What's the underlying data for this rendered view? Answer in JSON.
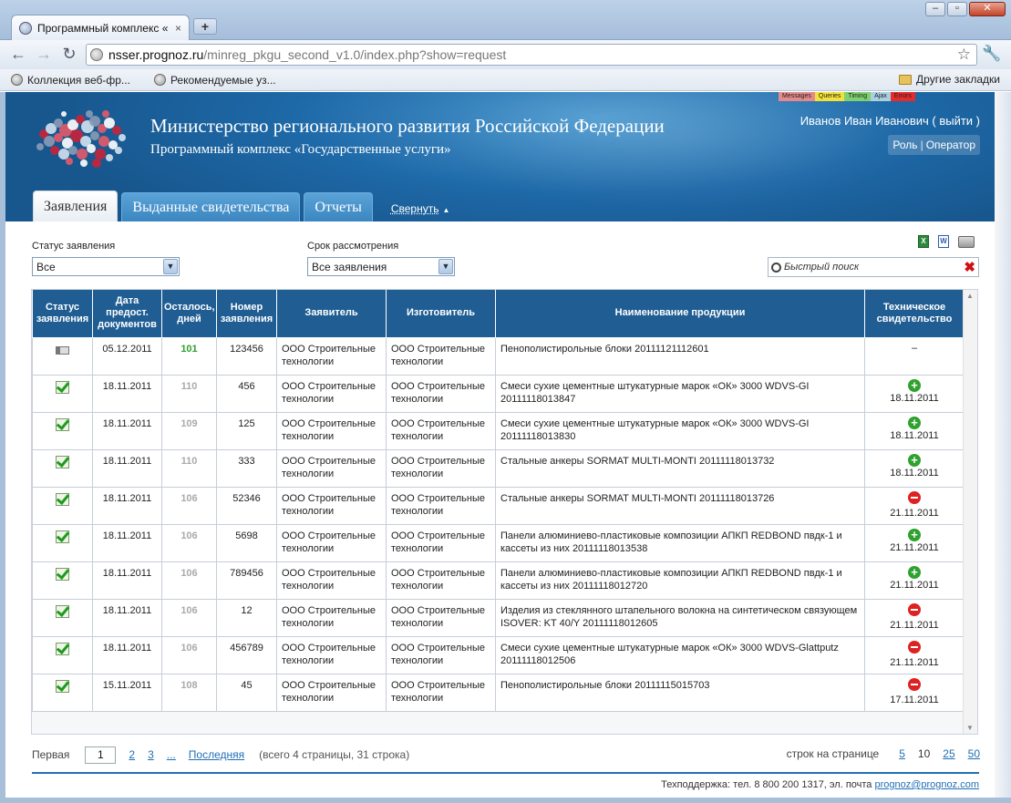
{
  "browser": {
    "tab_title": "Программный комплекс «",
    "tab_close": "×",
    "new_tab": "+",
    "url_host": "nsser.prognoz.ru",
    "url_path": "/minreg_pkgu_second_v1.0/index.php?show=request",
    "bookmarks": [
      "Коллекция веб-фр...",
      "Рекомендуемые уз..."
    ],
    "other_bookmarks": "Другие закладки"
  },
  "debug_bar": [
    {
      "label": "Messages",
      "color": "#e58a8a"
    },
    {
      "label": "Queries",
      "color": "#f2e23a"
    },
    {
      "label": "Timing",
      "color": "#7fd06e"
    },
    {
      "label": "Ajax",
      "color": "#a9cfe0"
    },
    {
      "label": "Errors",
      "color": "#e82a2a"
    }
  ],
  "header": {
    "ministry": "Министерство регионального развития Российской Федерации",
    "subtitle": "Программный комплекс «Государственные услуги»",
    "user": "Иванов Иван Иванович ( выйти )",
    "role_label": "Роль",
    "role_sep": "|",
    "role_value": "Оператор"
  },
  "nav": {
    "tabs": [
      "Заявления",
      "Выданные свидетельства",
      "Отчеты"
    ],
    "active": 0,
    "collapse": "Свернуть"
  },
  "filters": {
    "status_label": "Статус заявления",
    "status_value": "Все",
    "term_label": "Срок рассмотрения",
    "term_value": "Все заявления",
    "search_placeholder": "Быстрый поиск",
    "arrow": "▼"
  },
  "table": {
    "headers": [
      "Статус заявления",
      "Дата предост. документов",
      "Осталось, дней",
      "Номер заявления",
      "Заявитель",
      "Изготовитель",
      "Наименование продукции",
      "Техническое свидетельство"
    ],
    "rows": [
      {
        "status": "card",
        "date": "05.12.2011",
        "remaining": "101",
        "remaining_color": "green",
        "number": "123456",
        "applicant": "ООО Строительные технологии",
        "maker": "ООО Строительные технологии",
        "product": "Пенополистирольные блоки 20111121112601",
        "cert": "none",
        "cert_text": "–"
      },
      {
        "status": "check",
        "date": "18.11.2011",
        "remaining": "110",
        "remaining_color": "grey",
        "number": "456",
        "applicant": "ООО Строительные технологии",
        "maker": "ООО Строительные технологии",
        "product": "Смеси сухие цементные штукатурные марок «ОК» 3000 WDVS-GI 20111118013847",
        "cert": "plus",
        "cert_text": "18.11.2011"
      },
      {
        "status": "check",
        "date": "18.11.2011",
        "remaining": "109",
        "remaining_color": "grey",
        "number": "125",
        "applicant": "ООО Строительные технологии",
        "maker": "ООО Строительные технологии",
        "product": "Смеси сухие цементные штукатурные марок «ОК» 3000 WDVS-GI 20111118013830",
        "cert": "plus",
        "cert_text": "18.11.2011"
      },
      {
        "status": "check",
        "date": "18.11.2011",
        "remaining": "110",
        "remaining_color": "grey",
        "number": "333",
        "applicant": "ООО Строительные технологии",
        "maker": "ООО Строительные технологии",
        "product": "Стальные анкеры SORMAT MULTI-MONTI 20111118013732",
        "cert": "plus",
        "cert_text": "18.11.2011"
      },
      {
        "status": "check",
        "date": "18.11.2011",
        "remaining": "106",
        "remaining_color": "grey",
        "number": "52346",
        "applicant": "ООО Строительные технологии",
        "maker": "ООО Строительные технологии",
        "product": "Стальные анкеры SORMAT MULTI-MONTI 20111118013726",
        "cert": "minus",
        "cert_text": "21.11.2011"
      },
      {
        "status": "check",
        "date": "18.11.2011",
        "remaining": "106",
        "remaining_color": "grey",
        "number": "5698",
        "applicant": "ООО Строительные технологии",
        "maker": "ООО Строительные технологии",
        "product": "Панели алюминиево-пластиковые композиции АПКП REDBOND пвдк-1 и кассеты из них 20111118013538",
        "cert": "plus",
        "cert_text": "21.11.2011"
      },
      {
        "status": "check",
        "date": "18.11.2011",
        "remaining": "106",
        "remaining_color": "grey",
        "number": "789456",
        "applicant": "ООО Строительные технологии",
        "maker": "ООО Строительные технологии",
        "product": "Панели алюминиево-пластиковые композиции АПКП REDBOND пвдк-1 и кассеты из них 20111118012720",
        "cert": "plus",
        "cert_text": "21.11.2011"
      },
      {
        "status": "check",
        "date": "18.11.2011",
        "remaining": "106",
        "remaining_color": "grey",
        "number": "12",
        "applicant": "ООО Строительные технологии",
        "maker": "ООО Строительные технологии",
        "product": "Изделия из стеклянного штапельного волокна на синтетическом связующем ISOVER: KT 40/Y 20111118012605",
        "cert": "minus",
        "cert_text": "21.11.2011"
      },
      {
        "status": "check",
        "date": "18.11.2011",
        "remaining": "106",
        "remaining_color": "grey",
        "number": "456789",
        "applicant": "ООО Строительные технологии",
        "maker": "ООО Строительные технологии",
        "product": "Смеси сухие цементные штукатурные марок «ОК» 3000 WDVS-Glattputz 20111118012506",
        "cert": "minus",
        "cert_text": "21.11.2011"
      },
      {
        "status": "check",
        "date": "15.11.2011",
        "remaining": "108",
        "remaining_color": "grey",
        "number": "45",
        "applicant": "ООО Строительные технологии",
        "maker": "ООО Строительные технологии",
        "product": "Пенополистирольные блоки 20111115015703",
        "cert": "minus",
        "cert_text": "17.11.2011"
      }
    ]
  },
  "pager": {
    "first": "Первая",
    "current": "1",
    "pages": [
      "2",
      "3",
      "..."
    ],
    "last": "Последняя",
    "info": "(всего 4 страницы, 31 строка)",
    "per_page_label": "строк на странице",
    "per_page_options": [
      "5",
      "10",
      "25",
      "50"
    ],
    "per_page_current": "10"
  },
  "footer": {
    "support": "Техподдержка: тел. 8 800 200 1317, эл. почта ",
    "email": "prognoz@prognoz.com"
  }
}
